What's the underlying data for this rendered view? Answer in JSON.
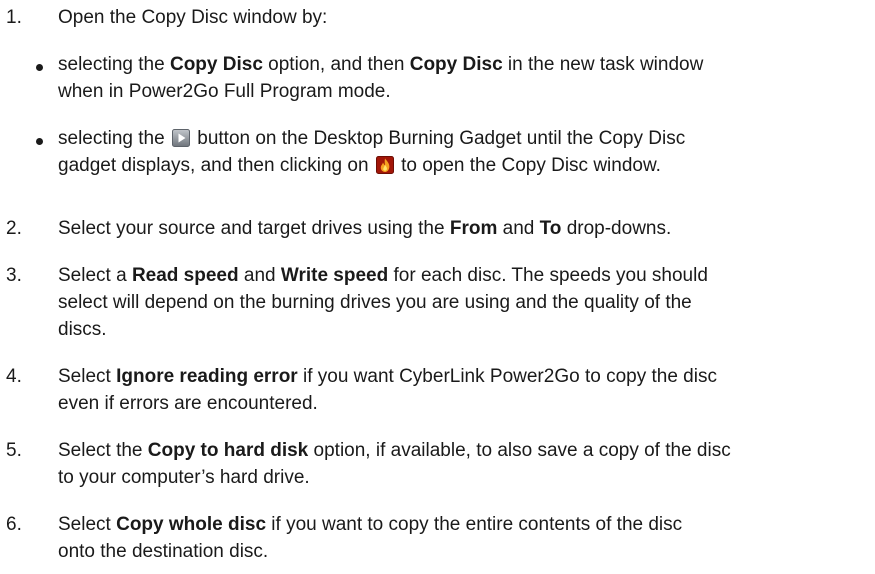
{
  "steps": [
    {
      "num": "1.",
      "text": "Open the Copy Disc window by:",
      "sub": [
        {
          "p1": "selecting the ",
          "b1": "Copy Disc",
          "p2": " option, and then ",
          "b2": "Copy Disc",
          "p3": " in the new task window",
          "l2": "when in Power2Go Full Program mode."
        },
        {
          "p1": "selecting the ",
          "p2": " button on the Desktop Burning Gadget until the Copy Disc",
          "l2a": "gadget displays, and then clicking on ",
          "l2b": " to open the Copy Disc window."
        }
      ]
    },
    {
      "num": "2.",
      "p1": "Select your source and target drives using the ",
      "b1": "From",
      "p2": " and ",
      "b2": "To",
      "p3": " drop-downs."
    },
    {
      "num": "3.",
      "p1": "Select a ",
      "b1": "Read speed",
      "p2": " and ",
      "b2": "Write speed",
      "p3": " for each disc. The speeds you should",
      "l2": "select will depend on the burning drives you are using and the quality of the",
      "l3": "discs."
    },
    {
      "num": "4.",
      "p1": "Select ",
      "b1": "Ignore reading error",
      "p2": " if you want CyberLink Power2Go to copy the disc",
      "l2": "even if errors are encountered."
    },
    {
      "num": "5.",
      "p1": "Select the ",
      "b1": "Copy to hard disk",
      "p2": " option, if available, to also save a copy of the disc",
      "l2": "to your computer’s hard drive."
    },
    {
      "num": "6.",
      "p1": "Select ",
      "b1": "Copy whole disc",
      "p2": " if you want to copy the entire contents of the disc",
      "l2": "onto the destination disc."
    }
  ],
  "icons": {
    "next_button": "play-arrow-button-icon",
    "burn_button": "flame-burn-icon"
  },
  "colors": {
    "text": "#1a1a1a",
    "icon_gray": "#8a8f95",
    "flame_red": "#d62a10",
    "flame_orange": "#f5a020"
  }
}
